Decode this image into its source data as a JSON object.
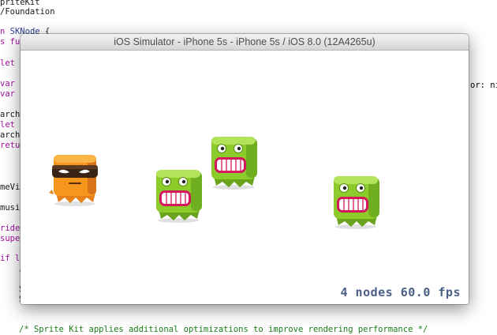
{
  "window": {
    "title": "iOS Simulator - iPhone 5s - iPhone 5s / iOS 8.0 (12A4265u)"
  },
  "stats": {
    "text": "4 nodes 60.0 fps"
  },
  "code": {
    "line_import_1": "priteKit",
    "line_import_2": "/Foundation",
    "line_class_kw": "n ",
    "line_class_type": "SKNode",
    "line_class_rest": " {",
    "line_func_kw": "s fun",
    "line_let_1": "let p",
    "line_var_1": "var s",
    "line_var_2": "var a",
    "line_archi_1": "archi",
    "line_let_2": "let s",
    "line_archi_2": "archi",
    "line_return": "retur",
    "line_meview": "meVie",
    "line_music": "music",
    "line_ride": "ride",
    "line_super": "super",
    "line_if": "if le",
    "line_slash": "/",
    "line_s1": "S",
    "line_s2": "S",
    "right_or": "or: ni",
    "comment_bottom": "/* Sprite Kit applies additional optimizations to improve rendering performance */"
  },
  "sprites": [
    {
      "name": "ninja-monster-sprite",
      "kind": "orange-ninja"
    },
    {
      "name": "green-monster-sprite",
      "kind": "green-monster"
    },
    {
      "name": "green-monster-sprite",
      "kind": "green-monster"
    },
    {
      "name": "green-monster-sprite",
      "kind": "green-monster"
    }
  ],
  "colors": {
    "stats_text": "#4a5f86",
    "monster_green": "#8ccc2a",
    "monster_orange": "#f7961c",
    "titlebar": "#e6e6e6"
  }
}
